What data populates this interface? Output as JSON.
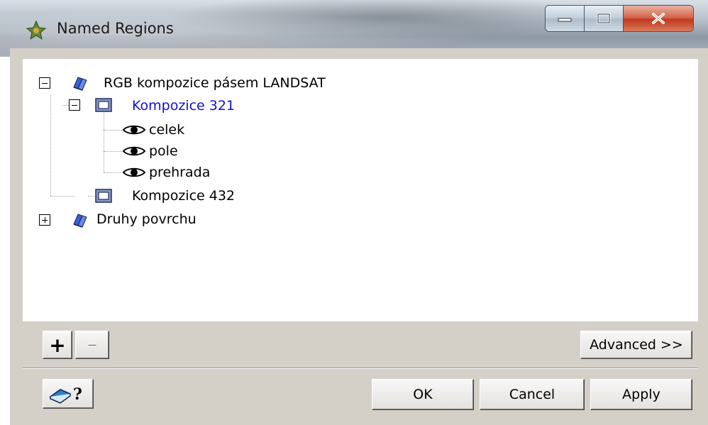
{
  "window": {
    "title": "Named Regions"
  },
  "tree": {
    "nodes": [
      {
        "label": "RGB kompozice pásem LANDSAT",
        "type": "group",
        "expanded": true
      },
      {
        "label": "Kompozice 321",
        "type": "region",
        "expanded": true,
        "selected": true
      },
      {
        "label": "celek",
        "type": "view"
      },
      {
        "label": "pole",
        "type": "view"
      },
      {
        "label": "prehrada",
        "type": "view"
      },
      {
        "label": "Kompozice 432",
        "type": "region"
      },
      {
        "label": "Druhy povrchu",
        "type": "group",
        "expanded": false
      }
    ]
  },
  "toolbar": {
    "add_label": "+",
    "remove_label": "—",
    "advanced_label": "Advanced >>"
  },
  "footer": {
    "ok_label": "OK",
    "cancel_label": "Cancel",
    "apply_label": "Apply"
  },
  "colors": {
    "selected_text": "#1010d0",
    "close_button": "#c0391e"
  }
}
